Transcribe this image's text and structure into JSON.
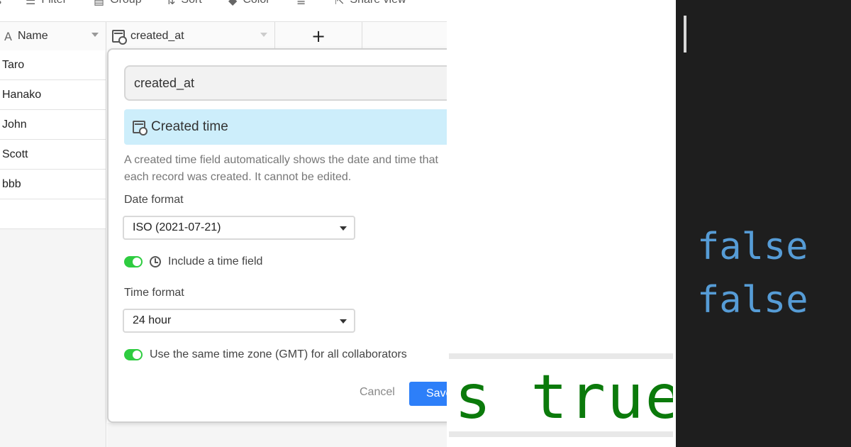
{
  "toolbar": {
    "items": [
      {
        "label": "Filter",
        "icon": "filter-icon"
      },
      {
        "label": "Group",
        "icon": "group-icon"
      },
      {
        "label": "Sort",
        "icon": "sort-icon"
      },
      {
        "label": "Color",
        "icon": "color-icon"
      },
      {
        "label": "",
        "icon": "row-height-icon"
      },
      {
        "label": "Share view",
        "icon": "share-icon"
      }
    ]
  },
  "grid": {
    "columns": [
      {
        "label": "Name",
        "icon": "text-field-icon"
      },
      {
        "label": "created_at",
        "icon": "calendar-icon"
      },
      {
        "label": "+",
        "icon": "add-column-icon"
      }
    ],
    "rows": [
      "Taro",
      "Hanako",
      "John",
      "Scott",
      "bbb"
    ]
  },
  "modal": {
    "field_name": "created_at",
    "field_type": "Created time",
    "description_line1": "A created time field automatically shows the date and time that",
    "description_line2": "each record was created. It cannot be edited.",
    "date_format_label": "Date format",
    "date_format_value": "ISO (2021-07-21)",
    "include_time_label": "Include a time field",
    "include_time_on": true,
    "time_format_label": "Time format",
    "time_format_value": "24 hour",
    "same_timezone_label": "Use the same time zone (GMT) for all collaborators",
    "same_timezone_on": true,
    "cancel_label": "Cancel",
    "save_label": "Save"
  },
  "code_light": {
    "text": "is true",
    "color": "#0b7a0b"
  },
  "terminal": {
    "lines": [
      "false",
      "false"
    ],
    "text_color": "#569cd6",
    "background": "#1e1e1e"
  },
  "colors": {
    "toggle_on": "#2ecc40",
    "selected_type_bg": "#cdeefb",
    "save_button": "#2d7ff9"
  }
}
